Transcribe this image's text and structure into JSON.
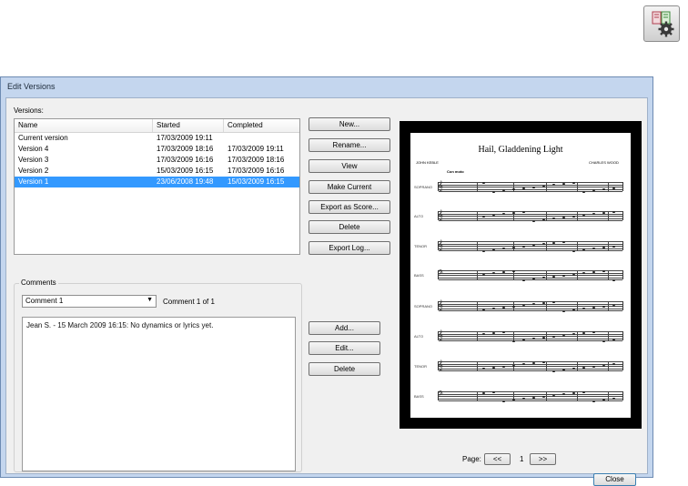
{
  "dialog": {
    "title": "Edit Versions",
    "close_label": "Close"
  },
  "versions": {
    "label": "Versions:",
    "columns": [
      "Name",
      "Started",
      "Completed"
    ],
    "rows": [
      {
        "name": "Current version",
        "started": "17/03/2009 19:11",
        "completed": "",
        "selected": false
      },
      {
        "name": "Version 4",
        "started": "17/03/2009 18:16",
        "completed": "17/03/2009 19:11",
        "selected": false
      },
      {
        "name": "Version 3",
        "started": "17/03/2009 16:16",
        "completed": "17/03/2009 18:16",
        "selected": false
      },
      {
        "name": "Version 2",
        "started": "15/03/2009 16:15",
        "completed": "17/03/2009 16:16",
        "selected": false
      },
      {
        "name": "Version 1",
        "started": "23/06/2008 19:48",
        "completed": "15/03/2009 16:15",
        "selected": true
      }
    ],
    "buttons": {
      "new": "New...",
      "rename": "Rename...",
      "view": "View",
      "make_current": "Make Current",
      "export_score": "Export as Score...",
      "delete": "Delete",
      "export_log": "Export Log..."
    }
  },
  "comments": {
    "label": "Comments",
    "selected": "Comment 1",
    "count": "Comment 1 of 1",
    "text": "Jean S. - 15 March 2009 16:15: No dynamics or lyrics yet.",
    "buttons": {
      "add": "Add...",
      "edit": "Edit...",
      "delete": "Delete"
    }
  },
  "preview": {
    "score_title": "Hail, Gladdening Light",
    "composer_left": "JOHN KEBLE",
    "composer_right": "CHARLES WOOD",
    "tempo": "Con moto",
    "staff_labels": [
      "SOPRANO",
      "ALTO",
      "TENOR",
      "BASS",
      "SOPRANO",
      "ALTO",
      "TENOR",
      "BASS"
    ]
  },
  "pagination": {
    "label": "Page:",
    "prev": "<<",
    "current": "1",
    "next": ">>"
  },
  "icons": {
    "toolbar": "score-settings-gear-icon",
    "dropdown": "chevron-down-icon"
  },
  "colors": {
    "selection": "#3399ff",
    "frame": "#c4d6ee"
  }
}
